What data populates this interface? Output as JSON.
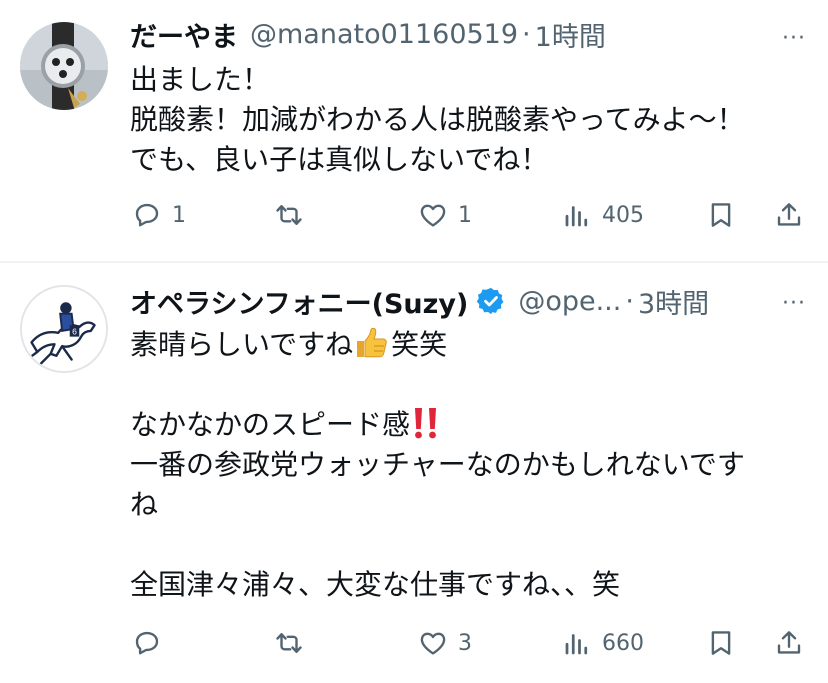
{
  "tweets": [
    {
      "display_name": "だーやま",
      "handle": "@manato01160519",
      "separator": "·",
      "time": "1時間",
      "more_label": "···",
      "lines": [
        "出ました！",
        "脱酸素！加減がわかる人は脱酸素やってみよ〜！",
        "でも、良い子は真似しないでね！"
      ],
      "replies": "1",
      "retweets": "",
      "likes": "1",
      "views": "405",
      "avatar_icon": "watch-photo-avatar"
    },
    {
      "display_name": "オペラシンフォニー(Suzy)",
      "handle": "@ope...",
      "separator": "·",
      "time": "3時間",
      "more_label": "···",
      "verified": true,
      "line1_text": "素晴らしいですね",
      "line1_suffix": "笑笑",
      "line3_text": "なかなかのスピード感",
      "line4": "一番の参政党ウォッチャーなのかもしれないです",
      "line5": "ね",
      "line7": "全国津々浦々、大変な仕事ですね、、笑",
      "replies": "",
      "retweets": "",
      "likes": "3",
      "views": "660",
      "avatar_icon": "racehorse-jockey-avatar"
    }
  ],
  "colors": {
    "text": "#0f1419",
    "muted": "#536471",
    "divider": "#eff3f4",
    "verified": "#1d9bf0"
  }
}
